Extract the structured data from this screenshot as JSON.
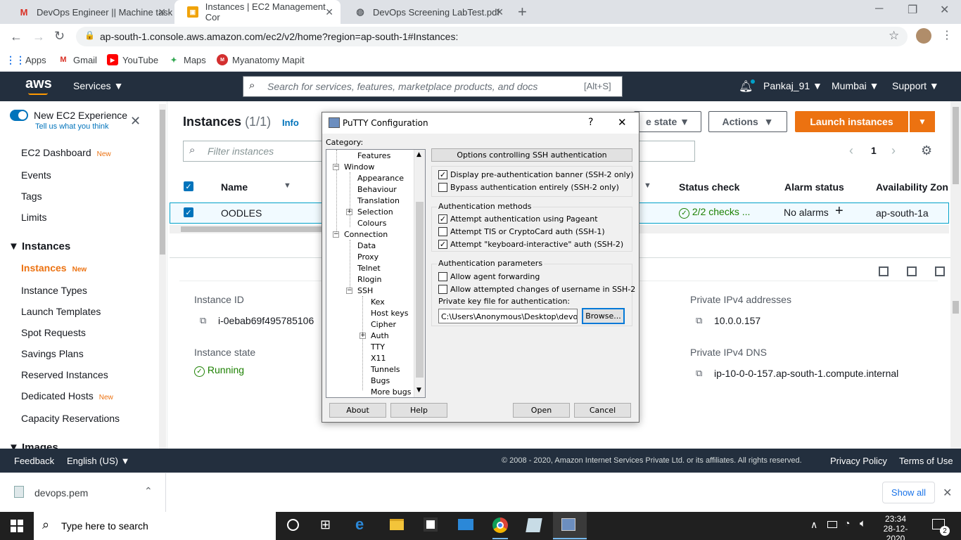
{
  "browser": {
    "tabs": [
      {
        "title": "DevOps Engineer || Machine task",
        "icon": "gmail-icon"
      },
      {
        "title": "Instances | EC2 Management Cor",
        "icon": "aws-icon"
      },
      {
        "title": "DevOps Screening LabTest.pdf",
        "icon": "globe-icon"
      }
    ],
    "url": "ap-south-1.console.aws.amazon.com/ec2/v2/home?region=ap-south-1#Instances:",
    "bookmarks": [
      "Apps",
      "Gmail",
      "YouTube",
      "Maps",
      "Myanatomy Mapit"
    ]
  },
  "aws": {
    "logo": "aws",
    "services": "Services",
    "search_placeholder": "Search for services, features, marketplace products, and docs",
    "search_shortcut": "[Alt+S]",
    "user": "Pankaj_91",
    "region": "Mumbai",
    "support": "Support"
  },
  "sidebar": {
    "toggle_label": "New EC2 Experience",
    "toggle_sub": "Tell us what you think",
    "new_badge": "New",
    "items": {
      "dashboard": "EC2 Dashboard",
      "events": "Events",
      "tags": "Tags",
      "limits": "Limits",
      "section_instances": "Instances",
      "instances": "Instances",
      "instance_types": "Instance Types",
      "launch_templates": "Launch Templates",
      "spot_requests": "Spot Requests",
      "savings_plans": "Savings Plans",
      "reserved_instances": "Reserved Instances",
      "dedicated_hosts": "Dedicated Hosts",
      "capacity_reservations": "Capacity Reservations",
      "section_images": "Images"
    }
  },
  "main": {
    "title": "Instances",
    "count": "(1/1)",
    "info": "Info",
    "instance_state_btn": "e state",
    "actions_btn": "Actions",
    "launch_btn": "Launch instances",
    "filter_placeholder": "Filter instances",
    "page": "1",
    "columns": {
      "name": "Name",
      "status_check": "Status check",
      "alarm_status": "Alarm status",
      "az": "Availability Zon"
    },
    "row": {
      "name": "OODLES",
      "status_check": "2/2 checks ...",
      "alarm_status": "No alarms",
      "az": "ap-south-1a"
    },
    "details": {
      "instance_id_label": "Instance ID",
      "instance_id": "i-0ebab69f495785106",
      "instance_state_label": "Instance state",
      "instance_state": "Running",
      "private_ipv4_label": "Private IPv4 addresses",
      "private_ipv4": "10.0.0.157",
      "private_dns_label": "Private IPv4 DNS",
      "private_dns": "ip-10-0-0-157.ap-south-1.compute.internal"
    }
  },
  "footer": {
    "feedback": "Feedback",
    "language": "English (US)",
    "copyright": "© 2008 - 2020, Amazon Internet Services Private Ltd. or its affiliates. All rights reserved.",
    "privacy": "Privacy Policy",
    "terms": "Terms of Use"
  },
  "downloads": {
    "file": "devops.pem",
    "show_all": "Show all"
  },
  "taskbar": {
    "search_placeholder": "Type here to search",
    "time": "23:34",
    "date": "28-12-2020",
    "notifications": "2"
  },
  "putty": {
    "title": "PuTTY Configuration",
    "help_q": "?",
    "category_label": "Category:",
    "tree": [
      "Features",
      "Window",
      "Appearance",
      "Behaviour",
      "Translation",
      "Selection",
      "Colours",
      "Connection",
      "Data",
      "Proxy",
      "Telnet",
      "Rlogin",
      "SSH",
      "Kex",
      "Host keys",
      "Cipher",
      "Auth",
      "TTY",
      "X11",
      "Tunnels",
      "Bugs",
      "More bugs"
    ],
    "panel_header": "Options controlling SSH authentication",
    "opt_banner": "Display pre-authentication banner (SSH-2 only)",
    "opt_bypass": "Bypass authentication entirely (SSH-2 only)",
    "methods_label": "Authentication methods",
    "opt_pageant": "Attempt authentication using Pageant",
    "opt_tis": "Attempt TIS or CryptoCard auth (SSH-1)",
    "opt_kbd": "Attempt \"keyboard-interactive\" auth (SSH-2)",
    "params_label": "Authentication parameters",
    "opt_agent_fwd": "Allow agent forwarding",
    "opt_user_change": "Allow attempted changes of username in SSH-2",
    "keyfile_label": "Private key file for authentication:",
    "keyfile_value": "C:\\Users\\Anonymous\\Desktop\\devops.p",
    "browse": "Browse...",
    "about": "About",
    "help": "Help",
    "open": "Open",
    "cancel": "Cancel",
    "checks": {
      "banner": true,
      "bypass": false,
      "pageant": true,
      "tis": false,
      "kbd": true,
      "agent_fwd": false,
      "user_change": false
    }
  },
  "colors": {
    "aws_dark": "#232f3e",
    "aws_orange": "#ec7211",
    "link_blue": "#0073bb",
    "success_green": "#1d8102"
  }
}
